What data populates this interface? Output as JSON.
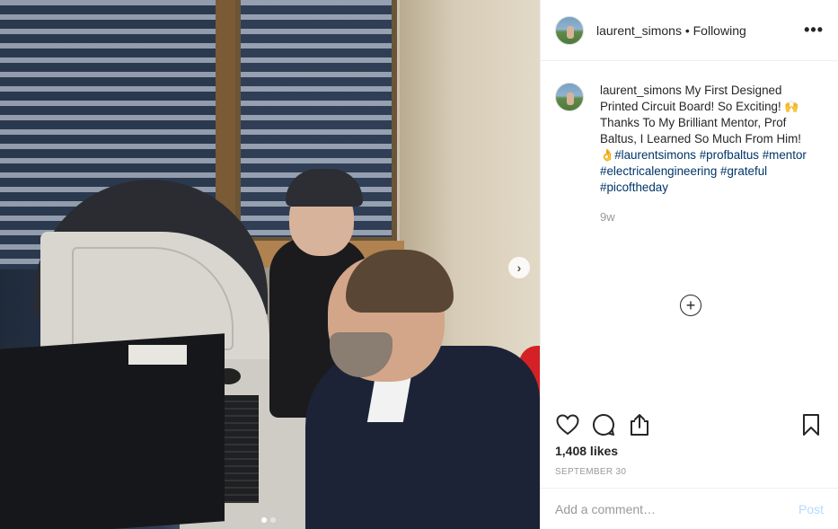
{
  "post": {
    "username": "laurent_simons",
    "separator": " • ",
    "follow_status": "Following",
    "more_label": "•••",
    "caption": {
      "username": "laurent_simons",
      "text_1": " My First Designed Printed Circuit Board! So Exciting! ",
      "emoji_1": "🙌",
      "text_2": " Thanks To My Brilliant Mentor, Prof Baltus, I Learned So Much From Him! ",
      "emoji_2": "👌",
      "hashtags": [
        "#laurentsimons",
        "#profbaltus",
        "#mentor",
        "#electricalengineering",
        "#grateful",
        "#picoftheday"
      ]
    },
    "time_ago": "9w",
    "load_more_label": "+",
    "likes": "1,408 likes",
    "date": "September 30",
    "comment_placeholder": "Add a comment…",
    "post_label": "Post",
    "next_arrow": "›",
    "carousel": {
      "count": 2,
      "active": 0
    }
  }
}
